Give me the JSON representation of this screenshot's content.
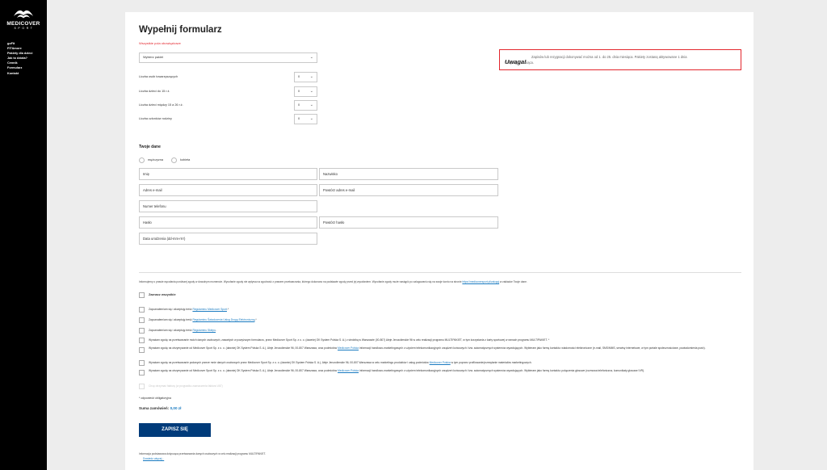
{
  "sidebar": {
    "logo_text": "MEDICOVER",
    "logo_sub": "SPORT",
    "nav": [
      "goFit",
      "FIT&more",
      "Pakiety dla dzieci",
      "Jak to działa?",
      "Cennik",
      "Formularz",
      "Kontakt"
    ]
  },
  "form": {
    "title": "Wypełnij formularz",
    "required_note": "Wszystkie pola obowiązkowe",
    "package_select": "Wybierz pakiet",
    "counts": [
      {
        "label": "Liczba osób towarzyszących",
        "value": "0"
      },
      {
        "label": "Liczba dzieci do 15 r.ż.",
        "value": "0"
      },
      {
        "label": "Liczba dzieci między 15 a 26 r.ż.",
        "value": "0"
      },
      {
        "label": "Liczba członków rodziny",
        "value": "0"
      }
    ],
    "chevron": "⌄"
  },
  "alert": {
    "title": "Uwaga!",
    "line1": "Zapisów lub rezygnacji dokonywać można od 1. do 25. dnia miesiąca. Pakiety zostaną aktywowane 1 dnia",
    "line2": "kolejnego miesiąca."
  },
  "personal": {
    "title": "Twoje dane",
    "gender_male": "mężczyzna",
    "gender_female": "kobieta",
    "fields": {
      "first_name": "Imię",
      "last_name": "Nazwisko",
      "email": "Adres e-mail",
      "email_repeat": "Powtórz adres e-mail",
      "phone": "Numer telefonu",
      "password": "Hasło",
      "password_repeat": "Powtórz hasło",
      "birthdate": "Data urodzenia (dd-mm-rrrr)"
    }
  },
  "consents": {
    "info_prefix": "Informujemy o prawie wycofania poniższej zgody w dowolnym momencie. Wycofanie zgody nie wpływa na zgodność z prawem przetwarzania, którego dokonano na podstawie zgody przed jej wycofaniem. Wycofanie zgody może nastąpić po zalogowaniu się na swoje konto na stronie",
    "info_link": "https://medicoversport.pl/zaloguj",
    "info_suffix": "w zakładce Twoje dane.",
    "select_all": "Zaznacz wszystkie",
    "items": [
      {
        "prefix": "Zapoznałem/am się i akceptuję treść",
        "link": "Regulaminu Medicover Sport",
        "suffix": ".*"
      },
      {
        "prefix": "Zapoznałem/am się i akceptuję treść",
        "link": "Regulaminu Świadczenia Usług Drogą Elektroniczną",
        "suffix": ".*"
      },
      {
        "prefix": "Zapoznałem/am się i akceptuję treść",
        "link": "Regulaminu Sklepu",
        "suffix": "."
      },
      {
        "prefix": "Wyrażam zgodę na przetwarzanie moich danych osobowych, zawartych w powyższym formularzu, przez Medicover Sport Sp. z o. o. (dawniej OK System Polska S. A.) z siedzibą w Warszawie (00-807) Aleje Jerozolimskie 96 w celu realizacji programu MULTIPAKIET, w tym korzystania z karty sportowej w ramach programu MULTIPAKIET. *",
        "link": "",
        "suffix": ""
      },
      {
        "prefix": "Wyrażam zgodę na otrzymywanie od Medicover Sport Sp. z o. o. (dawniej OK System Polska S. A.), Aleje Jerozolimskie 96, 00-807 Warszawa, oraz podmiotów",
        "link": "Medicover Polska",
        "suffix": "informacji handlowo-marketingowych z użyciem telekomunikacyjnych urządzeń końcowych i tzw. automatycznych systemów wywołujących. Wybieram jako formę kontaktu: wiadomości elektroniczne (e-mail, SMS/MMS, serwisy internetowe, w tym portale społecznościowe, powiadomienia push)."
      },
      {
        "prefix": "Wyrażam zgodę na przetwarzanie podanych przeze mnie danych osobowych przez Medicover Sport Sp. z o. o. (dawniej OK System Polska S. A.), Aleje Jerozolimskie 96, 00-807 Warszawa w celu marketingu produktów i usług podmiotów",
        "link": "Medicover Polska",
        "suffix": "w tym poprzez profilowanie/przesyłanie materiałów marketingowych."
      },
      {
        "prefix": "Wyrażam zgodę na otrzymywanie od Medicover Sport Sp. z o. o. (dawniej OK System Polska S. A.), Aleje Jerozolimskie 96, 00-807 Warszawa, oraz podmiotów",
        "link": "Medicover Polska",
        "suffix": "informacji handlowo-marketingowych z użyciem telekomunikacyjnych urządzeń końcowych i tzw. automatycznych systemów wywołujących. Wybieram jako formę kontaktu: połączenia głosowe (rozmowa telefoniczna, komunikaty głosowe IVR)."
      }
    ],
    "disabled_item": "Chcę otrzymać fakturę (w przypadku zaznaczenia faktura VAT)",
    "required_foot": "* odpowiedź obligatoryjna"
  },
  "summary": {
    "label": "Suma zamówień:",
    "value": "0,00 zł"
  },
  "submit_label": "ZAPISZ SIĘ",
  "footnote": {
    "text": "Informacja podstawowa dotycząca przetwarzania danych osobowych w celu realizacji programu MULTIPAKIET.",
    "link": "Dowiedz więcej..."
  }
}
